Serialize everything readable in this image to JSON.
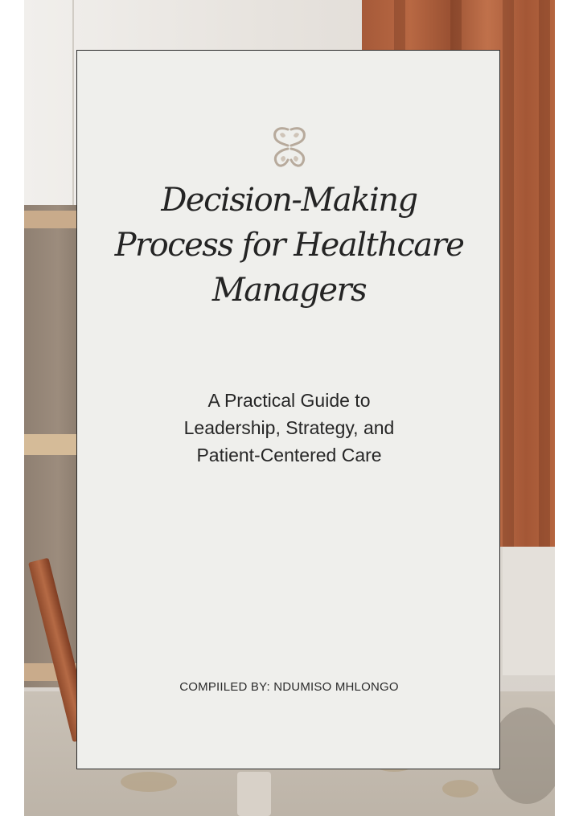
{
  "cover": {
    "title_lines": [
      "Decision-Making",
      "Process for Healthcare",
      "Managers"
    ],
    "subtitle_lines": [
      "A Practical Guide to",
      "Leadership, Strategy, and",
      "Patient-Centered Care"
    ],
    "author": "COMPIILED BY: NDUMISO MHLONGO",
    "logo": "butterfly-icon"
  },
  "colors": {
    "card_background": "#efefec",
    "card_border": "#2a2a2a",
    "text": "#242424",
    "logo": "#b7aa9c",
    "curtain": "#a65a39"
  }
}
